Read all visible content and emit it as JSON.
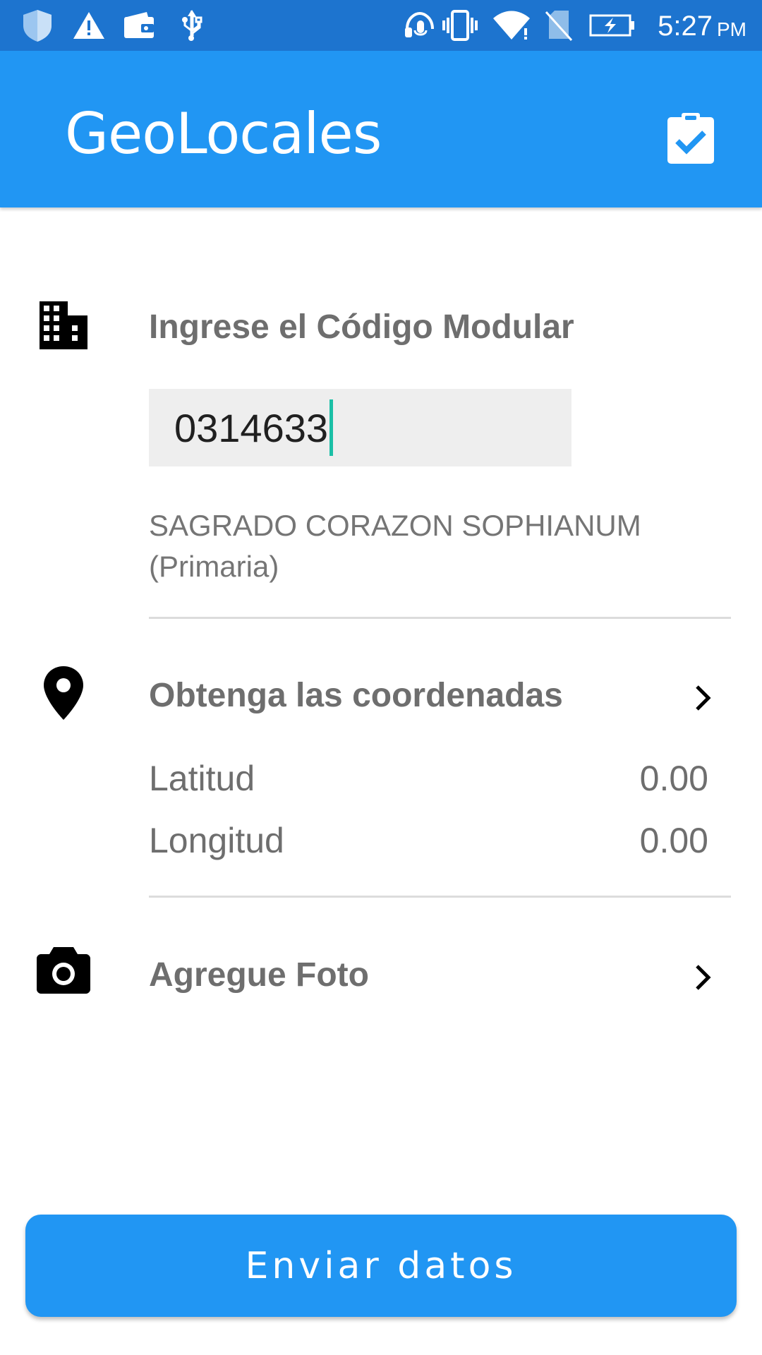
{
  "status_bar": {
    "icons": [
      "shield-icon",
      "warning-icon",
      "wallet-icon",
      "usb-icon",
      "headset-mic-icon",
      "vibrate-icon",
      "wifi-icon",
      "no-sim-icon",
      "battery-charging-icon"
    ],
    "time": "5:27",
    "ampm": "PM"
  },
  "app_bar": {
    "title": "GeoLocales",
    "action_icon": "clipboard-check-icon"
  },
  "school_section": {
    "icon": "building-icon",
    "title": "Ingrese el Código Modular",
    "code_value": "0314633",
    "school_name": "SAGRADO CORAZON SOPHIANUM (Primaria)"
  },
  "coordinates_section": {
    "icon": "map-pin-icon",
    "title": "Obtenga las coordenadas",
    "latitude_label": "Latitud",
    "latitude_value": "0.00",
    "longitude_label": "Longitud",
    "longitude_value": "0.00"
  },
  "photo_section": {
    "icon": "camera-icon",
    "title": "Agregue Foto"
  },
  "send_button": {
    "label": "Enviar datos"
  },
  "colors": {
    "status_bar": "#1d74cf",
    "app_bar": "#2196f3",
    "button": "#2196f3",
    "caret": "#1bbfa6",
    "text_gray": "#6e6e6e"
  }
}
